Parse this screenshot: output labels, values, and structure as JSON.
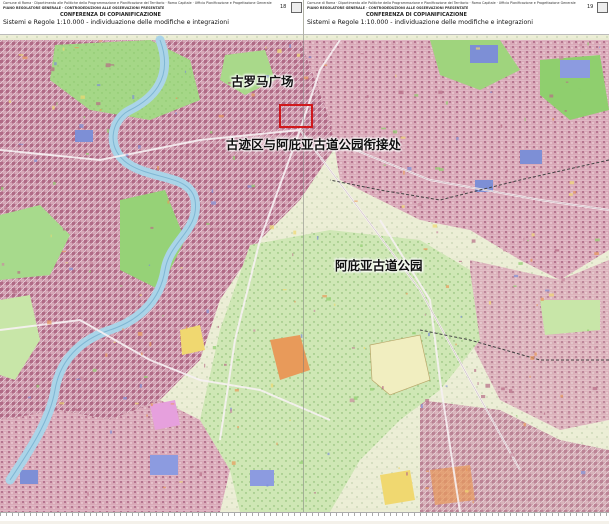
{
  "map": {
    "labels": {
      "forum": "古罗马广场",
      "junction": "古迹区与阿庇亚古道公园衔接处",
      "appia": "阿庇亚古道公园"
    }
  },
  "sheets": {
    "left": {
      "line1": "Comune di Roma · Dipartimento alle Politiche della Programmazione e Pianificazione del Territorio · Roma Capitale · Ufficio Pianificazione e Progettazione Generale",
      "line2": "PIANO REGOLATORE GENERALE · CONTRODEDUZIONI ALLE OSSERVAZIONI PRESENTATE",
      "conference": "CONFERENZA DI COPIANIFICAZIONE",
      "title": "Sistemi e Regole 1:10.000 - individuazione delle modifiche e integrazioni",
      "number": "18"
    },
    "right": {
      "line1": "Comune di Roma · Dipartimento alle Politiche della Programmazione e Pianificazione del Territorio · Roma Capitale · Ufficio Pianificazione e Progettazione Generale",
      "line2": "PIANO REGOLATORE GENERALE · CONTRODEDUZIONI ALLE OSSERVAZIONI PRESENTATE",
      "conference": "CONFERENZA DI COPIANIFICAZIONE",
      "title": "Sistemi e Regole 1:10.000 - individuazione delle modifiche e integrazioni",
      "number": "19"
    }
  },
  "colors": {
    "urban_dense": "#b76c86",
    "urban_mid": "#c98c9f",
    "urban_light": "#dba7b4",
    "green_park": "#8fcf6e",
    "green_light": "#c8e6a8",
    "agricultural": "#eef0d8",
    "river": "#aad4e8",
    "services_blue": "#7d8fd6",
    "orange_zone": "#e89a5a",
    "yellow_zone": "#f0d870",
    "highlight_red": "#d0181c"
  }
}
